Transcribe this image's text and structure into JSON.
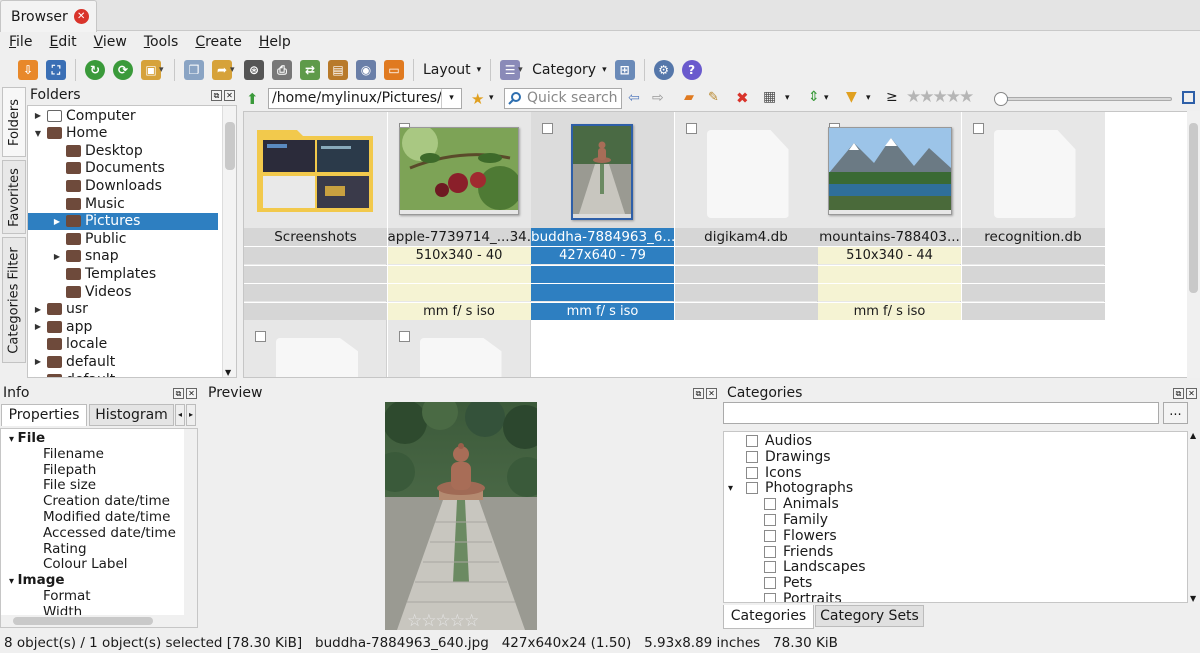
{
  "tab": {
    "title": "Browser"
  },
  "menu": [
    "File",
    "Edit",
    "View",
    "Tools",
    "Create",
    "Help"
  ],
  "toolbar": {
    "layout_label": "Layout",
    "category_label": "Category"
  },
  "side_tabs": [
    "Folders",
    "Favorites",
    "Categories Filter"
  ],
  "folders": {
    "header": "Folders",
    "items": [
      {
        "label": "Computer",
        "level": 0,
        "expand": "right"
      },
      {
        "label": "Home",
        "level": 0,
        "expand": "down"
      },
      {
        "label": "Desktop",
        "level": 1,
        "expand": ""
      },
      {
        "label": "Documents",
        "level": 1,
        "expand": ""
      },
      {
        "label": "Downloads",
        "level": 1,
        "expand": ""
      },
      {
        "label": "Music",
        "level": 1,
        "expand": ""
      },
      {
        "label": "Pictures",
        "level": 1,
        "expand": "right",
        "selected": true
      },
      {
        "label": "Public",
        "level": 1,
        "expand": ""
      },
      {
        "label": "snap",
        "level": 1,
        "expand": "right"
      },
      {
        "label": "Templates",
        "level": 1,
        "expand": ""
      },
      {
        "label": "Videos",
        "level": 1,
        "expand": ""
      },
      {
        "label": "usr",
        "level": 0,
        "expand": "right"
      },
      {
        "label": "app",
        "level": 0,
        "expand": "right"
      },
      {
        "label": "locale",
        "level": 0,
        "expand": ""
      },
      {
        "label": "default",
        "level": 0,
        "expand": "right"
      },
      {
        "label": "default",
        "level": 0,
        "expand": "right"
      }
    ]
  },
  "address": {
    "path": "/home/mylinux/Pictures/",
    "search_placeholder": "Quick search"
  },
  "thumbnails": [
    {
      "name": "Screenshots",
      "info": "",
      "exif": "",
      "kind": "folder",
      "checkbox": false
    },
    {
      "name": "apple-7739714_...34...",
      "info": "510x340 - 40",
      "exif": "mm f/ s iso",
      "kind": "apple",
      "checkbox": true
    },
    {
      "name": "buddha-7884963_6...",
      "info": "427x640 - 79",
      "exif": "mm f/ s iso",
      "kind": "buddha",
      "checkbox": true,
      "selected": true
    },
    {
      "name": "digikam4.db",
      "info": "",
      "exif": "",
      "kind": "doc",
      "checkbox": true
    },
    {
      "name": "mountains-788403...",
      "info": "510x340 - 44",
      "exif": "mm f/ s iso",
      "kind": "mountains",
      "checkbox": true
    },
    {
      "name": "recognition.db",
      "info": "",
      "exif": "",
      "kind": "doc",
      "checkbox": true
    }
  ],
  "info_panel": {
    "header": "Info",
    "tabs": [
      "Properties",
      "Histogram"
    ],
    "rows": [
      {
        "label": "File",
        "group": true
      },
      {
        "label": "Filename"
      },
      {
        "label": "Filepath"
      },
      {
        "label": "File size"
      },
      {
        "label": "Creation date/time"
      },
      {
        "label": "Modified date/time"
      },
      {
        "label": "Accessed date/time"
      },
      {
        "label": "Rating"
      },
      {
        "label": "Colour Label"
      },
      {
        "label": "Image",
        "group": true
      },
      {
        "label": "Format"
      },
      {
        "label": "Width"
      }
    ]
  },
  "preview": {
    "header": "Preview",
    "rating_stars": 0
  },
  "categories": {
    "header": "Categories",
    "more_label": "...",
    "items": [
      {
        "label": "Audios",
        "level": 0
      },
      {
        "label": "Drawings",
        "level": 0
      },
      {
        "label": "Icons",
        "level": 0
      },
      {
        "label": "Photographs",
        "level": 0,
        "expanded": true
      },
      {
        "label": "Animals",
        "level": 1
      },
      {
        "label": "Family",
        "level": 1
      },
      {
        "label": "Flowers",
        "level": 1
      },
      {
        "label": "Friends",
        "level": 1
      },
      {
        "label": "Landscapes",
        "level": 1
      },
      {
        "label": "Pets",
        "level": 1
      },
      {
        "label": "Portraits",
        "level": 1
      }
    ],
    "tabs": [
      "Categories",
      "Category Sets"
    ]
  },
  "status": {
    "selection": "8 object(s) / 1 object(s) selected [78.30 KiB]",
    "filename": "buddha-7884963_640.jpg",
    "dimensions": "427x640x24 (1.50)",
    "print_size": "5.93x8.89 inches",
    "size": "78.30 KiB"
  },
  "colors": {
    "accent": "#2e7fc1",
    "close": "#d9342b",
    "exif_bg": "#f5f3d3"
  }
}
